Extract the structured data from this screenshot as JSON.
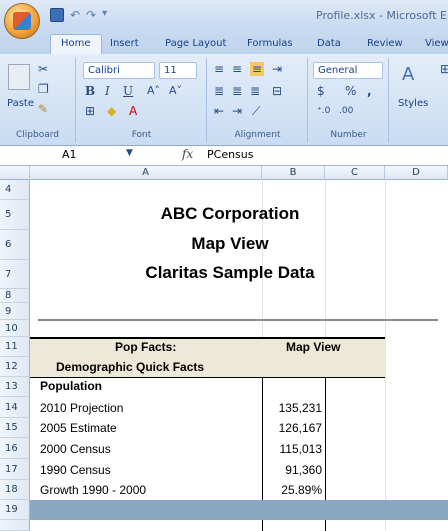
{
  "window": {
    "title": "Profile.xlsx - Microsoft E"
  },
  "tabs": [
    {
      "label": "Home"
    },
    {
      "label": "Insert"
    },
    {
      "label": "Page Layout"
    },
    {
      "label": "Formulas"
    },
    {
      "label": "Data"
    },
    {
      "label": "Review"
    },
    {
      "label": "View"
    }
  ],
  "ribbon": {
    "clipboard": {
      "label": "Clipboard",
      "paste": "Paste"
    },
    "font": {
      "label": "Font",
      "name": "Calibri",
      "size": "11"
    },
    "alignment": {
      "label": "Alignment"
    },
    "number": {
      "label": "Number",
      "format": "General",
      "currency": "$",
      "percent": "%",
      "comma": ","
    },
    "styles": {
      "label": "Styles"
    }
  },
  "formula_bar": {
    "name_box": "A1",
    "fx": "fx",
    "value": "PCensus"
  },
  "columns": [
    "A",
    "B",
    "C",
    "D"
  ],
  "rows": [
    "4",
    "5",
    "6",
    "7",
    "8",
    "9",
    "10",
    "11",
    "12",
    "13",
    "14",
    "15",
    "16",
    "17",
    "18",
    "19"
  ],
  "sheet": {
    "title1": "ABC Corporation",
    "title2": "Map View",
    "title3": "Claritas Sample Data",
    "header_left": "Pop Facts:",
    "header_right": "Map View",
    "subheader": "Demographic Quick Facts",
    "section": "Population",
    "data": [
      {
        "label": "2010 Projection",
        "value": "135,231"
      },
      {
        "label": "2005 Estimate",
        "value": "126,167"
      },
      {
        "label": "2000 Census",
        "value": "115,013"
      },
      {
        "label": "1990 Census",
        "value": "91,360"
      },
      {
        "label": "Growth 1990 - 2000",
        "value": "25.89%"
      }
    ]
  },
  "colors": {
    "header_fill": "#ede8d8",
    "band_fill": "#8ca7c0"
  }
}
